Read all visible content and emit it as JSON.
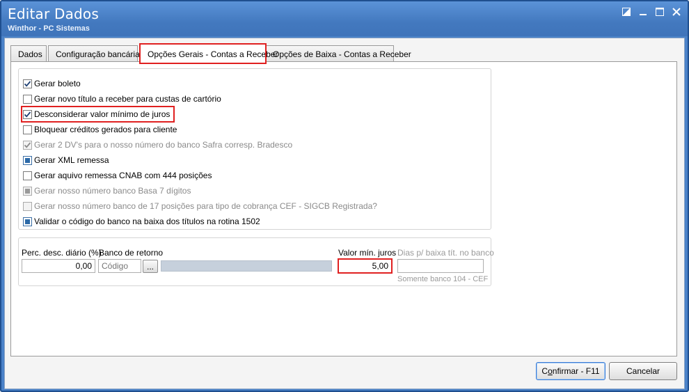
{
  "window": {
    "title": "Editar Dados",
    "subtitle": "Winthor - PC Sistemas"
  },
  "tabs": [
    {
      "label": "Dados"
    },
    {
      "label": "Configuração bancária"
    },
    {
      "label": "Opções Gerais - Contas a Receber"
    },
    {
      "label": "Opções de Baixa - Contas a Receber"
    }
  ],
  "active_tab": "Opções Gerais - Contas a Receber",
  "options": [
    {
      "label": "Gerar boleto",
      "state": "checked",
      "enabled": true
    },
    {
      "label": "Gerar novo título a receber para custas de cartório",
      "state": "unchecked",
      "enabled": true
    },
    {
      "label": "Desconsiderar valor mínimo de juros",
      "state": "checked",
      "enabled": true
    },
    {
      "label": "Bloquear créditos gerados para cliente",
      "state": "unchecked",
      "enabled": true
    },
    {
      "label": "Gerar 2 DV's para o nosso número do banco Safra corresp. Bradesco",
      "state": "checked",
      "enabled": false
    },
    {
      "label": "Gerar XML remessa",
      "state": "indeterminate",
      "enabled": true
    },
    {
      "label": "Gerar aquivo remessa CNAB com 444 posições",
      "state": "unchecked",
      "enabled": true
    },
    {
      "label": "Gerar nosso número banco Basa 7 dígitos",
      "state": "indeterminate",
      "enabled": false
    },
    {
      "label": "Gerar nosso número banco de 17 posições para tipo de cobrança CEF - SIGCB Registrada?",
      "state": "unchecked",
      "enabled": false
    },
    {
      "label": "Validar o código do banco na baixa dos títulos na rotina 1502",
      "state": "indeterminate",
      "enabled": true
    }
  ],
  "fields": {
    "perc_desc_label": "Perc. desc. diário (%)",
    "perc_desc_value": "0,00",
    "banco_retorno_label": "Banco de retorno",
    "banco_retorno_code_placeholder": "Código",
    "banco_retorno_browse": "...",
    "valor_min_juros_label": "Valor mín. juros",
    "valor_min_juros_value": "5,00",
    "dias_baixa_label": "Dias p/ baixa tít. no banco",
    "dias_baixa_value": "",
    "dias_baixa_hint": "Somente banco 104 - CEF"
  },
  "buttons": {
    "confirm_prefix": "C",
    "confirm_underlined": "o",
    "confirm_rest": "nfirmar - F11",
    "cancel": "Cancelar"
  },
  "colors": {
    "titlebar": "#4a82c8",
    "highlight": "#e02020",
    "check_blue": "#2c6aa8"
  }
}
